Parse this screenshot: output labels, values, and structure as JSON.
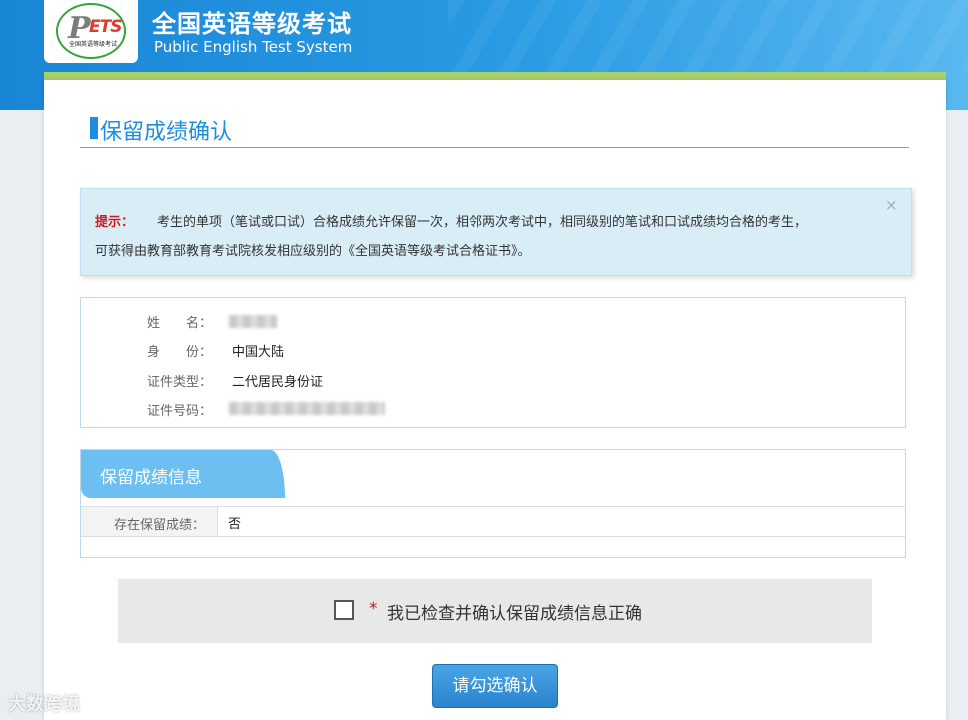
{
  "header": {
    "logo_letter_p": "P",
    "logo_letters": "ETS",
    "logo_subtext": "全国英语等级考试",
    "title": "全国英语等级考试",
    "subtitle": "Public English Test System"
  },
  "page": {
    "title": "保留成绩确认"
  },
  "alert": {
    "label": "提示：",
    "text_line1": "考生的单项（笔试或口试）合格成绩允许保留一次，相邻两次考试中，相同级别的笔试和口试成绩均合格的考生，",
    "text_line2": "可获得由教育部教育考试院核发相应级别的《全国英语等级考试合格证书》。",
    "close_symbol": "×"
  },
  "candidate": {
    "fields": [
      {
        "label": "姓　　名：",
        "value": ""
      },
      {
        "label": "身　　份：",
        "value": "中国大陆"
      },
      {
        "label": "证件类型：",
        "value": "二代居民身份证"
      },
      {
        "label": "证件号码：",
        "value": ""
      }
    ]
  },
  "retained": {
    "section_title": "保留成绩信息",
    "row_label": "存在保留成绩：",
    "row_value": "否"
  },
  "confirm": {
    "required_mark": "*",
    "checkbox_label": "我已检查并确认保留成绩信息正确",
    "checked": false,
    "button_label": "请勾选确认"
  },
  "watermark": {
    "text": "大数跨境"
  },
  "colors": {
    "primary_blue": "#1b8ee0",
    "header_blue": "#1a86d6",
    "accent_green": "#a9d06b",
    "alert_bg": "#d9edf7",
    "required_red": "#d01b1b",
    "tab_blue": "#6cbff0"
  },
  "icons": {
    "close": "close-icon",
    "checkbox": "checkbox-icon"
  }
}
